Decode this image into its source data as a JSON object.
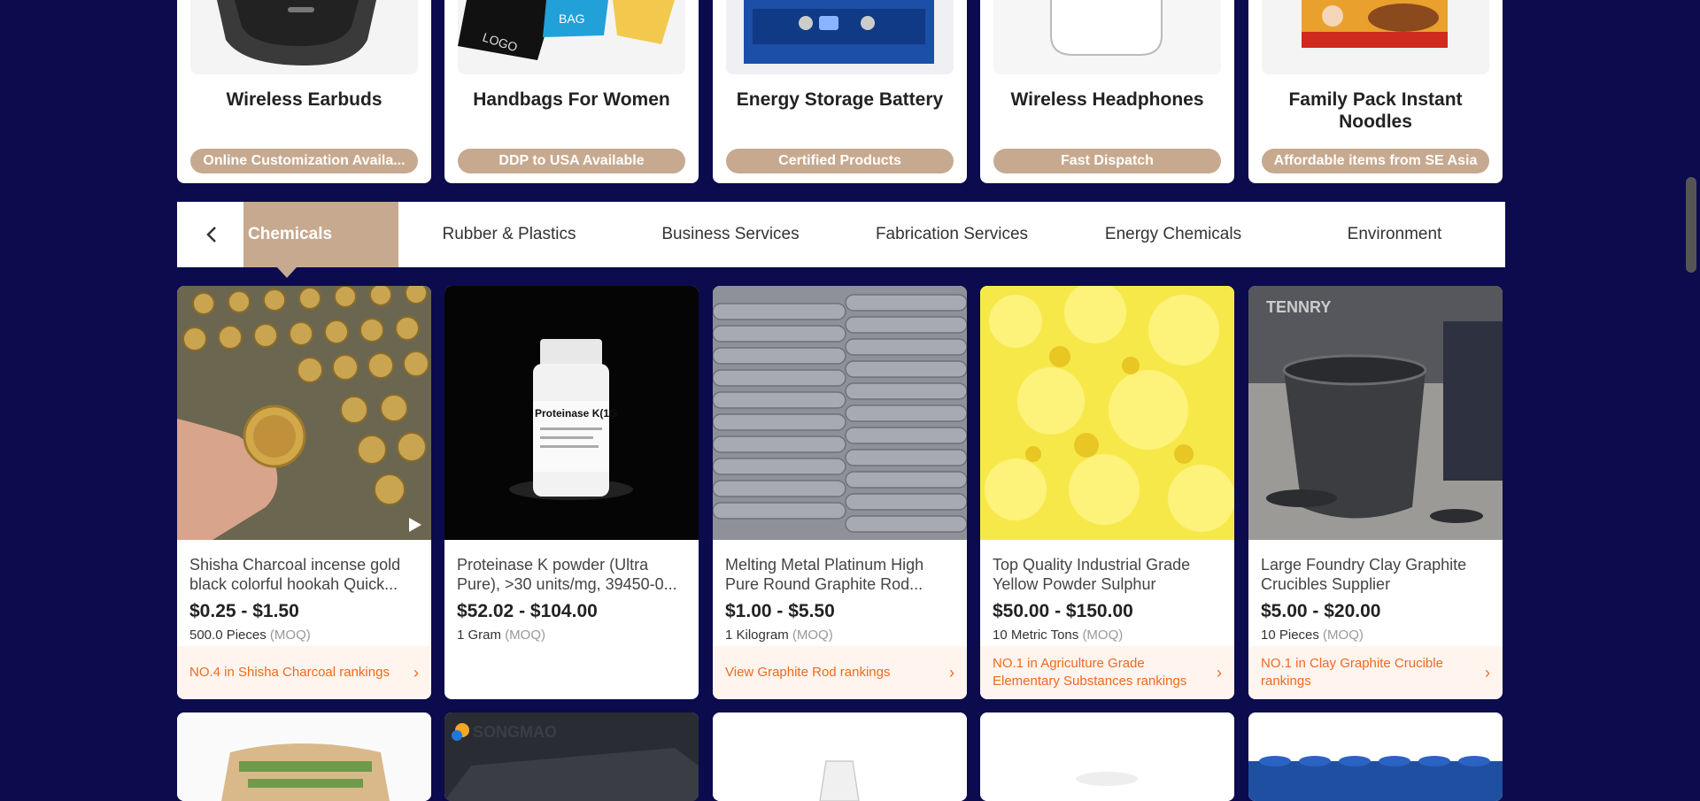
{
  "categories": [
    {
      "title": "Wireless Earbuds",
      "badge": "Online Customization Availa..."
    },
    {
      "title": "Handbags For Women",
      "badge": "DDP to USA Available"
    },
    {
      "title": "Energy Storage Battery",
      "badge": "Certified Products"
    },
    {
      "title": "Wireless Headphones",
      "badge": "Fast Dispatch"
    },
    {
      "title": "Family Pack Instant Noodles",
      "badge": "Affordable items from SE Asia"
    }
  ],
  "tabs": {
    "prev_icon": "chevron-left-icon",
    "items": [
      "Chemicals",
      "Rubber & Plastics",
      "Business Services",
      "Fabrication Services",
      "Energy Chemicals",
      "Environment"
    ]
  },
  "products": [
    {
      "title": "Shisha Charcoal incense gold black colorful hookah Quick...",
      "price": "$0.25 - $1.50",
      "moq_qty": "500.0 Pieces",
      "moq_label": "(MOQ)",
      "rank": "NO.4 in Shisha Charcoal rankings",
      "has_video": true
    },
    {
      "title": "Proteinase K powder (Ultra Pure), >30 units/mg, 39450-0...",
      "price": "$52.02 - $104.00",
      "moq_qty": "1 Gram",
      "moq_label": "(MOQ)",
      "rank": ""
    },
    {
      "title": "Melting Metal Platinum High Pure Round Graphite Rod...",
      "price": "$1.00 - $5.50",
      "moq_qty": "1 Kilogram",
      "moq_label": "(MOQ)",
      "rank": "View Graphite Rod rankings"
    },
    {
      "title": "Top Quality Industrial Grade Yellow Powder Sulphur",
      "price": "$50.00 - $150.00",
      "moq_qty": "10 Metric Tons",
      "moq_label": "(MOQ)",
      "rank": "NO.1 in Agriculture Grade Elementary Substances rankings"
    },
    {
      "title": "Large Foundry Clay Graphite Crucibles Supplier",
      "price": "$5.00 - $20.00",
      "moq_qty": "10 Pieces",
      "moq_label": "(MOQ)",
      "rank": "NO.1 in Clay Graphite Crucible rankings"
    }
  ],
  "image_texts": {
    "earbuds": "",
    "handbag_logo": "LOGO",
    "handbag_bag": "BAG",
    "proteinase_label": "Proteinase K(1G",
    "crucible_brand": "TENNRY",
    "songmao": "SONGMAO"
  },
  "colors": {
    "background": "#0b0b4d",
    "accent": "#c7a98f",
    "rank_text": "#f06a1d",
    "rank_bg": "#fff4ee"
  }
}
